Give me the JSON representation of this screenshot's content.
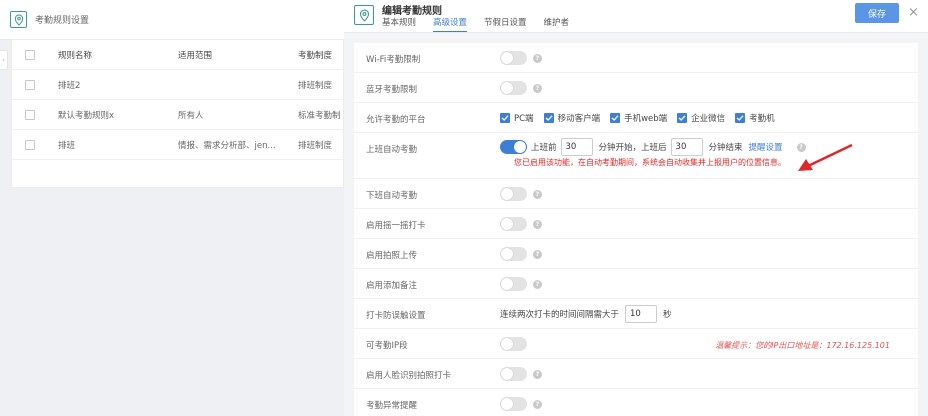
{
  "background": {
    "page_title": "考勤规则设置",
    "table": {
      "headers": [
        "规则名称",
        "适用范围",
        "考勤制度"
      ],
      "rows": [
        [
          "排班2",
          "",
          "排班制度"
        ],
        [
          "默认考勤规则x",
          "所有人",
          "标准考勤制"
        ],
        [
          "排班",
          "情报、需求分析部、jen...",
          "排班制度"
        ]
      ]
    }
  },
  "drawer": {
    "title": "编辑考勤规则",
    "tabs": [
      "基本规则",
      "高级设置",
      "节假日设置",
      "维护者"
    ],
    "active_tab": "高级设置",
    "save_label": "保存",
    "close_glyph": "×"
  },
  "settings": {
    "wifi": {
      "label": "Wi-Fi考勤限制",
      "enabled": false
    },
    "bluetooth": {
      "label": "蓝牙考勤限制",
      "enabled": false
    },
    "platform": {
      "label": "允许考勤的平台",
      "options": [
        "PC端",
        "移动客户端",
        "手机web端",
        "企业微信",
        "考勤机"
      ]
    },
    "auto_in": {
      "label": "上班自动考勤",
      "enabled": true,
      "before_text": "上班前",
      "before_value": "30",
      "start_text": "分钟开始，上班后",
      "after_value": "30",
      "end_text": "分钟结束",
      "reminder_link": "提醒设置",
      "warning": "您已启用该功能，在自动考勤期间，系统会自动收集并上报用户的位置信息。"
    },
    "auto_out": {
      "label": "下班自动考勤",
      "enabled": false
    },
    "shake": {
      "label": "启用摇一摇打卡",
      "enabled": false
    },
    "photo": {
      "label": "启用拍照上传",
      "enabled": false
    },
    "remark": {
      "label": "启用添加备注",
      "enabled": false
    },
    "anti_mistake": {
      "label": "打卡防误触设置",
      "prefix": "连续两次打卡的时间间隔需大于",
      "value": "10",
      "unit": "秒"
    },
    "ip": {
      "label": "可考勤IP段",
      "enabled": false,
      "hint": "温馨提示：您的IP出口地址是：172.16.125.101"
    },
    "face": {
      "label": "启用人脸识别拍照打卡",
      "enabled": false
    },
    "abnormal": {
      "label": "考勤异常提醒",
      "enabled": false
    }
  },
  "colors": {
    "accent": "#3e7fd6",
    "save_button": "#5b95e6",
    "warning": "#e02828",
    "logo": "#3a9c8a"
  },
  "icons": {
    "logo": "location-pin-icon",
    "help": "question-circle-icon",
    "arrow": "red-arrow-annotation-icon"
  }
}
